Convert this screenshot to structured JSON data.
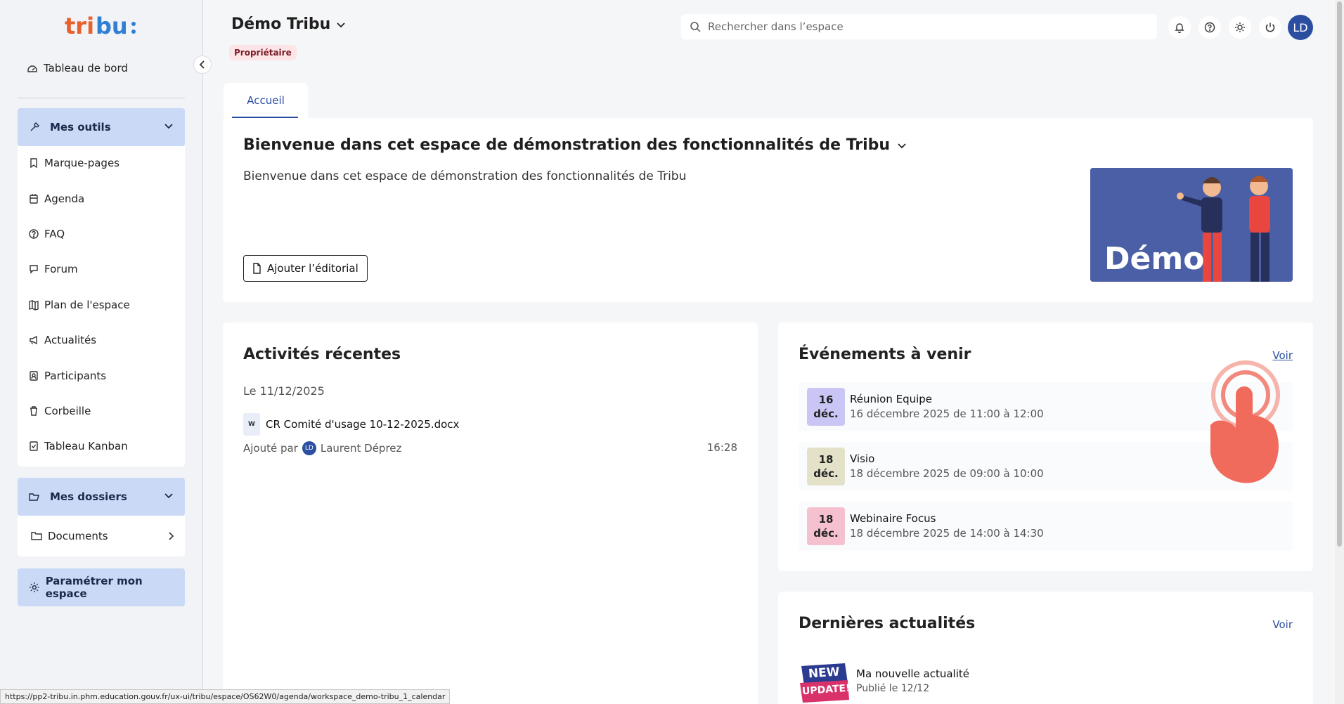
{
  "app": {
    "logo_text": "tribu:"
  },
  "sidebar": {
    "dashboard_label": "Tableau de bord",
    "tools": {
      "label": "Mes outils",
      "items": [
        {
          "label": "Marque-pages",
          "icon": "bookmark-icon"
        },
        {
          "label": "Agenda",
          "icon": "calendar-icon"
        },
        {
          "label": "FAQ",
          "icon": "help-icon"
        },
        {
          "label": "Forum",
          "icon": "forum-icon"
        },
        {
          "label": "Plan de l'espace",
          "icon": "map-icon"
        },
        {
          "label": "Actualités",
          "icon": "megaphone-icon"
        },
        {
          "label": "Participants",
          "icon": "participants-icon"
        },
        {
          "label": "Corbeille",
          "icon": "trash-icon"
        },
        {
          "label": "Tableau Kanban",
          "icon": "kanban-icon"
        }
      ]
    },
    "folders": {
      "label": "Mes dossiers",
      "items": [
        {
          "label": "Documents",
          "icon": "folder-icon"
        }
      ]
    },
    "settings_label": "Paramétrer mon espace"
  },
  "header": {
    "workspace_title": "Démo Tribu",
    "role_badge": "Propriétaire",
    "search_placeholder": "Rechercher dans l’espace",
    "avatar_initials": "LD"
  },
  "tabs": [
    {
      "label": "Accueil",
      "active": true
    }
  ],
  "editorial": {
    "title": "Bienvenue dans cet espace de démonstration des fonctionnalités de Tribu",
    "text": "Bienvenue dans cet espace de démonstration des fonctionnalités de Tribu",
    "add_button": "Ajouter l’éditorial",
    "image_text": "Démo"
  },
  "activities": {
    "title": "Activités récentes",
    "groups": [
      {
        "date_label": "Le 11/12/2025",
        "items": [
          {
            "file_icon_letter": "W",
            "file_name": "CR Comité d'usage 10-12-2025.docx",
            "added_by_prefix": "Ajouté par",
            "author_initials": "LD",
            "author": "Laurent Déprez",
            "time": "16:28"
          }
        ]
      }
    ]
  },
  "events": {
    "title": "Événements à venir",
    "voir": "Voir",
    "items": [
      {
        "day": "16",
        "month": "déc.",
        "title": "Réunion Equipe",
        "when": "16 décembre 2025 de 11:00 à 12:00",
        "color": "#c9c6f5"
      },
      {
        "day": "18",
        "month": "déc.",
        "title": "Visio",
        "when": "18 décembre 2025 de 09:00 à 10:00",
        "color": "#e3e2c9"
      },
      {
        "day": "18",
        "month": "déc.",
        "title": "Webinaire Focus",
        "when": "18 décembre 2025 de 14:00 à 14:30",
        "color": "#f6c1cf"
      }
    ]
  },
  "news": {
    "title": "Dernières actualités",
    "voir": "Voir",
    "items": [
      {
        "badge_line1": "NEW",
        "badge_line2": "UPDATE!",
        "title": "Ma nouvelle actualité",
        "date": "Publié le 12/12"
      }
    ]
  },
  "status_bar": {
    "url": "https://pp2-tribu.in.phm.education.gouv.fr/ux-ui/tribu/espace/OS62W0/agenda/workspace_demo-tribu_1_calendar"
  },
  "colors": {
    "accent": "#2b4ea0",
    "nav_group_bg": "#c9d9f6",
    "badge_bg": "#fde4e6"
  }
}
